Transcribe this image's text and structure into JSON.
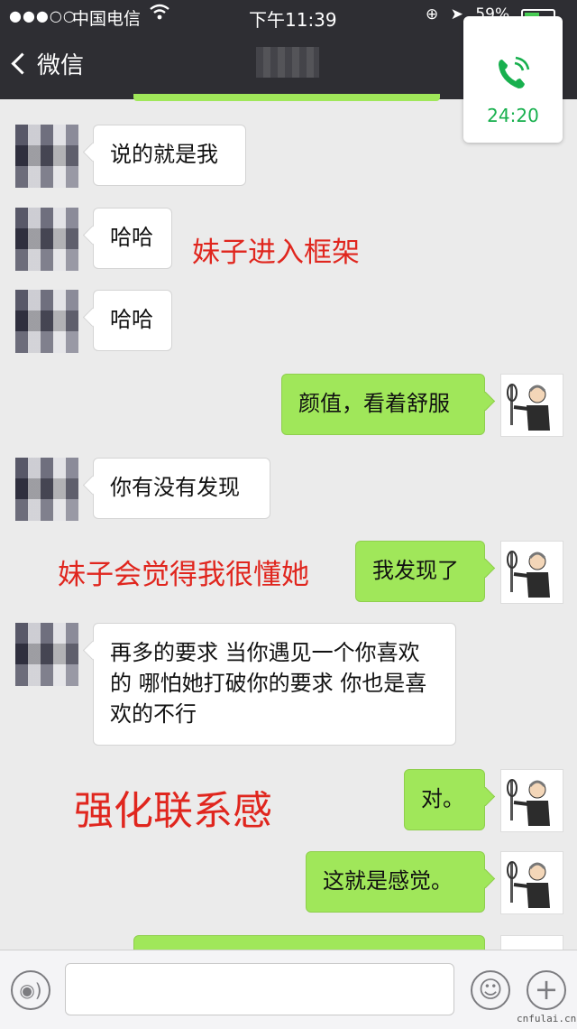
{
  "status_bar": {
    "signal": "●●●○○",
    "carrier": "中国电信",
    "time": "下午11:39",
    "battery_text": "59%"
  },
  "nav": {
    "back_label": "微信"
  },
  "call": {
    "duration": "24:20",
    "icon": "phone-icon"
  },
  "messages": [
    {
      "side": "left",
      "text": "说的就是我"
    },
    {
      "side": "left",
      "text": "哈哈"
    },
    {
      "side": "left",
      "text": "哈哈"
    },
    {
      "side": "right",
      "text": "颜值，看着舒服"
    },
    {
      "side": "left",
      "text": "你有没有发现"
    },
    {
      "side": "right",
      "text": "我发现了"
    },
    {
      "side": "left",
      "text": "再多的要求 当你遇见一个你喜欢的 哪怕她打破你的要求 你也是喜欢的不行"
    },
    {
      "side": "right",
      "text": "对。"
    },
    {
      "side": "right",
      "text": "这就是感觉。"
    }
  ],
  "annotations": [
    "妹子进入框架",
    "妹子会觉得我很懂她",
    "强化联系感"
  ],
  "colors": {
    "bubble_green": "#a0e75a",
    "annotation_red": "#e0261e",
    "call_green": "#18b04e"
  },
  "watermark": "cnfulai.cn"
}
